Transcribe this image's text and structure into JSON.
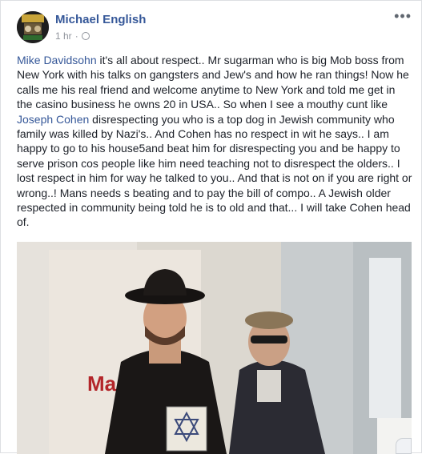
{
  "post": {
    "author": "Michael English",
    "time": "1 hr",
    "time_separator": "·",
    "more_label": "•••",
    "text_parts": [
      {
        "type": "mention",
        "text": "Mike Davidsohn"
      },
      {
        "type": "text",
        "text": " it's all about respect.. Mr sugarman who is big Mob boss from New York with his talks on gangsters and Jew's and how he ran things! Now he calls me his real friend and welcome anytime to New York and told me get in the casino business he owns 20 in USA.. So when I see a mouthy cunt like "
      },
      {
        "type": "mention",
        "text": "Joseph Cohen"
      },
      {
        "type": "text",
        "text": " disrespecting you who is a top dog in Jewish community who family was killed by Nazi's.. And Cohen has no respect in wit he says.. I am happy to go to his house5and beat him for disrespecting you and be happy to serve prison cos people like him need teaching not to disrespect the olders.. I lost respect in him for way he talked to you.. And that is not on if you are right or wrong..! Mans needs s beating and to pay the bill of compo.. A Jewish older respected in community being told he is to old and that... I will take Cohen head of."
      }
    ],
    "photo_book_label": "Ma"
  },
  "colors": {
    "link": "#365899",
    "meta": "#90949c",
    "text": "#1d2129"
  },
  "icons": [
    "avatar",
    "globe-icon",
    "more-options-icon"
  ]
}
